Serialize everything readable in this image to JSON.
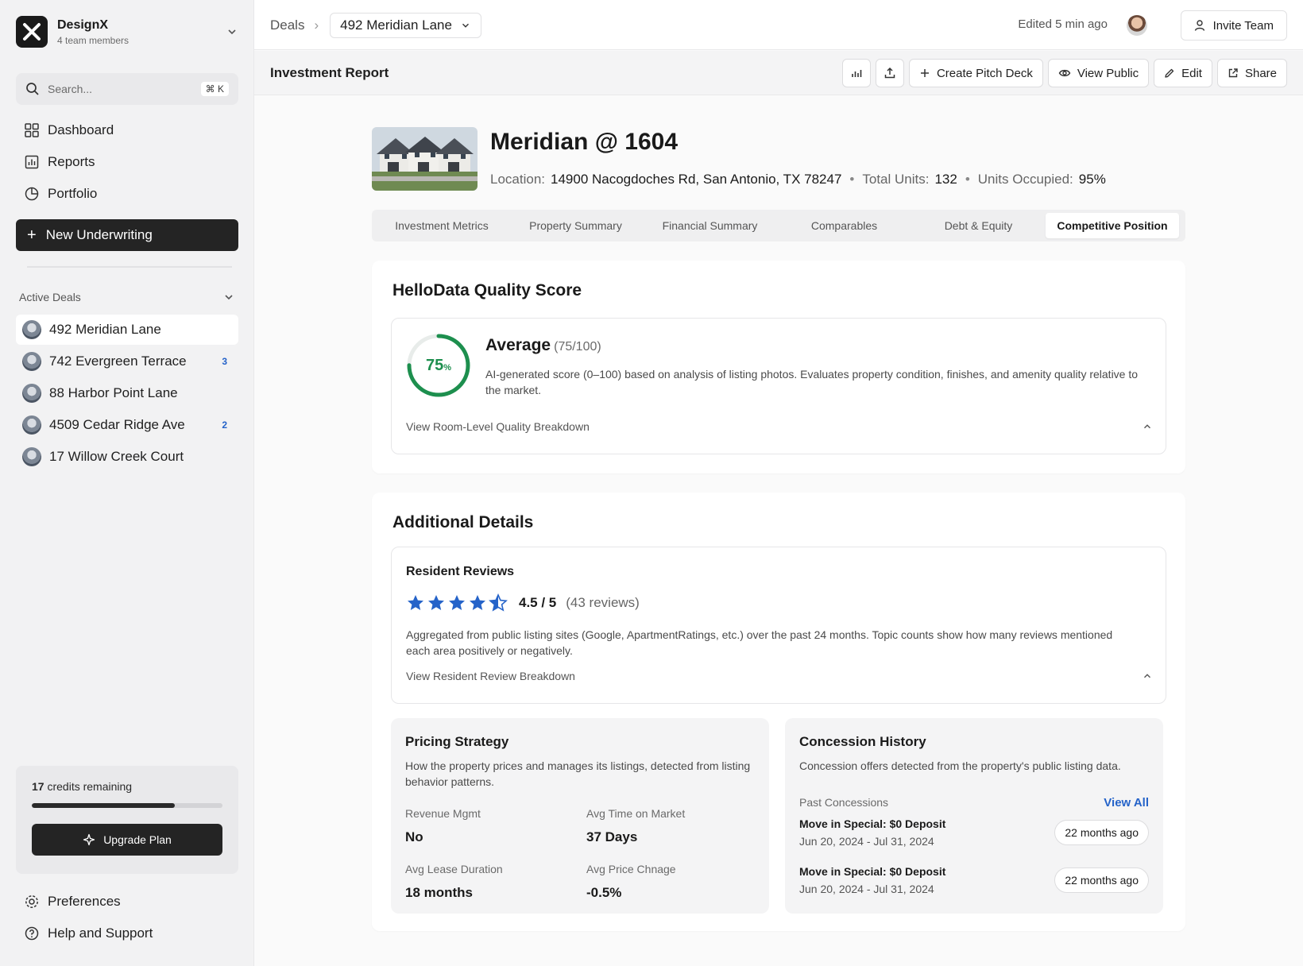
{
  "workspace": {
    "name": "DesignX",
    "members": "4 team members"
  },
  "search": {
    "placeholder": "Search...",
    "shortcut": "⌘ K"
  },
  "nav": {
    "dashboard": "Dashboard",
    "reports": "Reports",
    "portfolio": "Portfolio"
  },
  "new_underwriting": "New Underwriting",
  "active_deals": {
    "title": "Active Deals",
    "items": [
      {
        "label": "492 Meridian Lane",
        "count": ""
      },
      {
        "label": "742 Evergreen Terrace",
        "count": "3"
      },
      {
        "label": "88 Harbor Point Lane",
        "count": ""
      },
      {
        "label": "4509 Cedar Ridge Ave",
        "count": "2"
      },
      {
        "label": "17 Willow Creek Court",
        "count": ""
      }
    ]
  },
  "credits": {
    "count": "17",
    "label": "credits remaining",
    "progress_fraction": 0.75,
    "upgrade": "Upgrade Plan"
  },
  "bottom_nav": {
    "preferences": "Preferences",
    "help": "Help and Support"
  },
  "topbar": {
    "breadcrumb_root": "Deals",
    "current_deal": "492 Meridian Lane",
    "edited": "Edited 5 min ago",
    "invite": "Invite Team"
  },
  "subheader": {
    "title": "Investment Report",
    "create_pitch_deck": "Create Pitch Deck",
    "view_public": "View Public",
    "edit": "Edit",
    "share": "Share"
  },
  "property": {
    "name": "Meridian @ 1604",
    "location_label": "Location:",
    "location": "14900 Nacogdoches Rd, San Antonio, TX 78247",
    "units_label": "Total Units:",
    "units": "132",
    "occupied_label": "Units Occupied:",
    "occupied": "95%"
  },
  "tabs": [
    "Investment Metrics",
    "Property Summary",
    "Financial Summary",
    "Comparables",
    "Debt & Equity",
    "Competitive Position"
  ],
  "quality": {
    "title": "HelloData Quality Score",
    "score": 75,
    "score_label": "75",
    "percent_sign": "%",
    "rating": "Average",
    "rating_detail": "(75/100)",
    "description": "AI-generated score (0–100) based on analysis of listing photos. Evaluates property condition, finishes, and amenity quality relative to the market.",
    "breakdown": "View Room-Level Quality Breakdown",
    "ring_color": "#1d8f4e"
  },
  "additional": {
    "title": "Additional Details",
    "reviews": {
      "title": "Resident Reviews",
      "rating": 4.5,
      "score_text": "4.5 / 5",
      "count_text": "(43 reviews)",
      "description": "Aggregated from public listing sites (Google, ApartmentRatings, etc.) over the past 24 months. Topic counts show how many reviews mentioned each area positively or negatively.",
      "breakdown": "View Resident Review Breakdown",
      "star_color": "#2563c9"
    },
    "pricing": {
      "title": "Pricing Strategy",
      "description": "How the property prices and manages its listings, detected from listing behavior patterns.",
      "metrics": [
        {
          "label": "Revenue Mgmt",
          "value": "No"
        },
        {
          "label": "Avg Time on Market",
          "value": "37 Days"
        },
        {
          "label": "Avg Lease Duration",
          "value": "18 months"
        },
        {
          "label": "Avg Price Chnage",
          "value": "-0.5%"
        }
      ]
    },
    "concessions": {
      "title": "Concession History",
      "description": "Concession offers detected from the property's public listing data.",
      "past_label": "Past Concessions",
      "view_all": "View All",
      "items": [
        {
          "title": "Move in Special: $0 Deposit",
          "dates": "Jun 20, 2024 - Jul 31, 2024",
          "ago": "22 months ago"
        },
        {
          "title": "Move in Special: $0 Deposit",
          "dates": "Jun 20, 2024 - Jul 31, 2024",
          "ago": "22 months ago"
        }
      ]
    }
  }
}
